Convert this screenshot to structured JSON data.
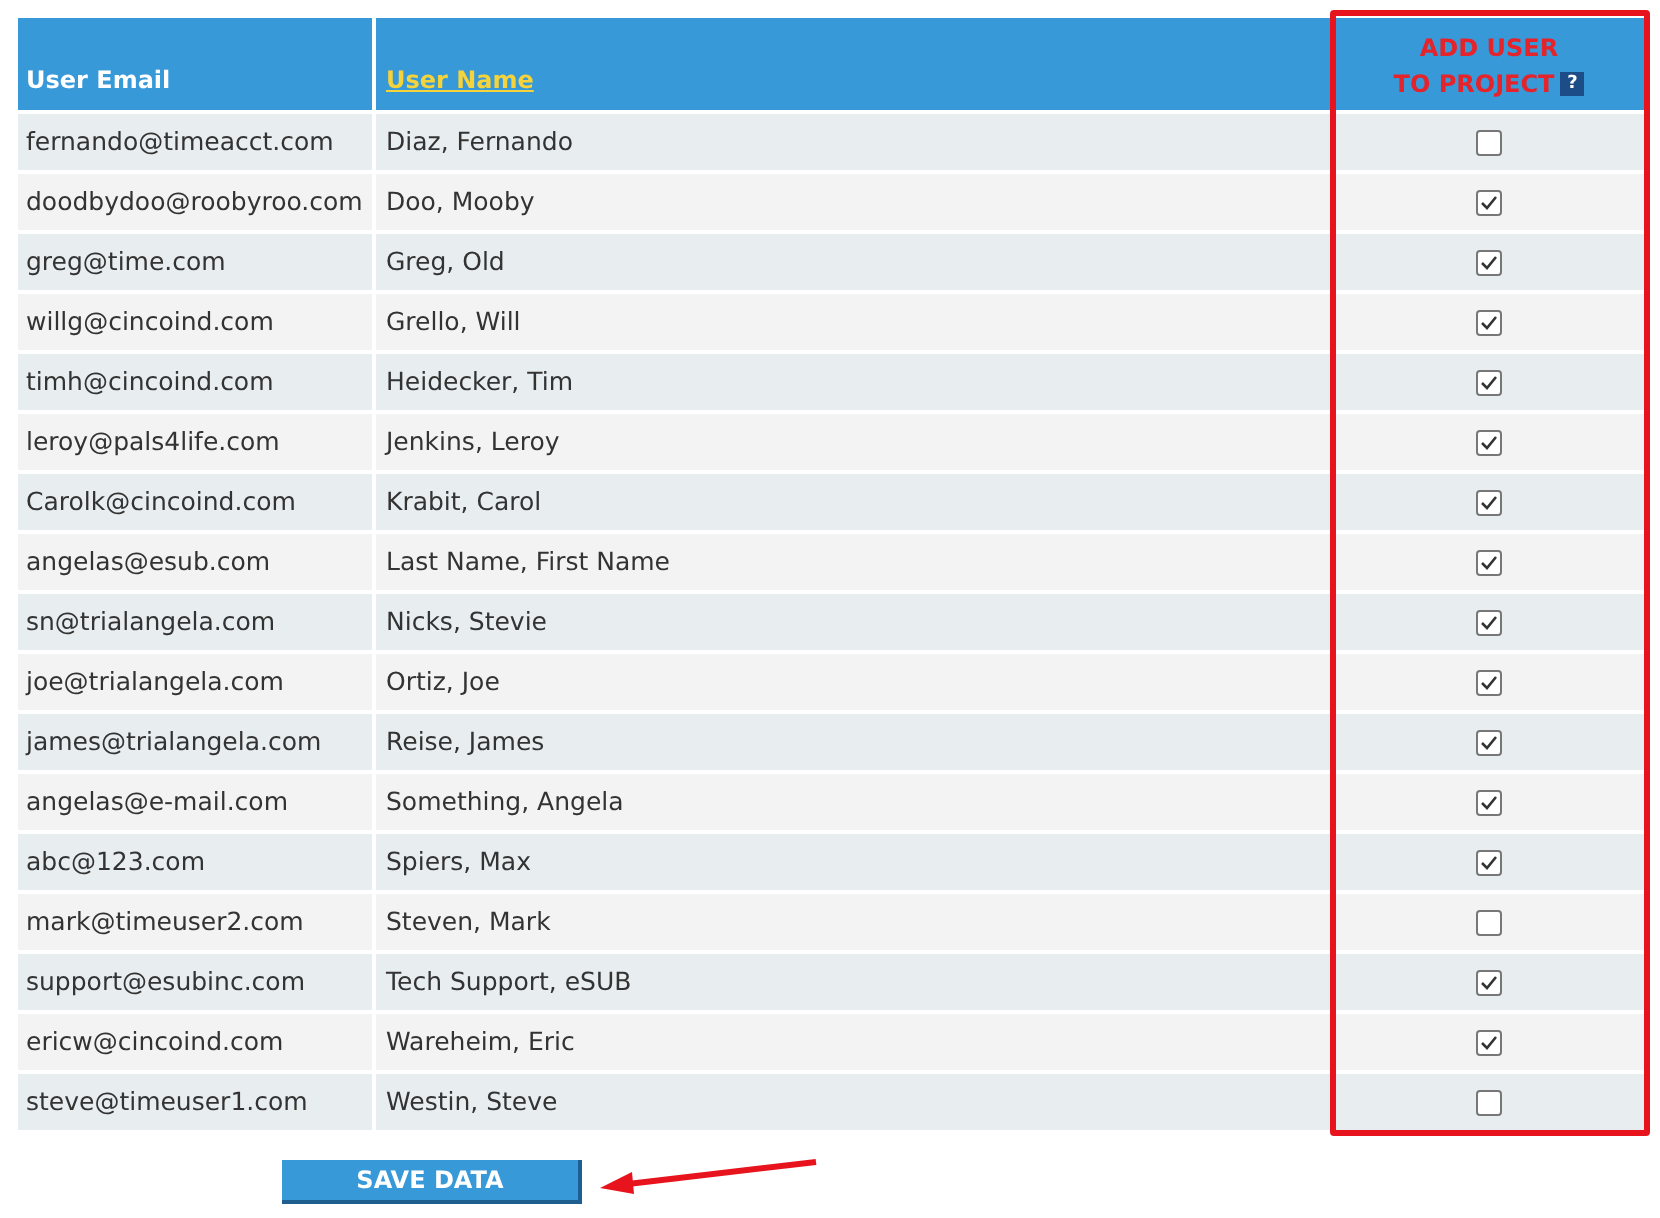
{
  "table": {
    "columns": [
      {
        "label": "User Email",
        "sortable": false
      },
      {
        "label": "User Name",
        "sortable": true
      },
      {
        "label_lines": [
          "ADD USER",
          "TO PROJECT"
        ],
        "help": "?"
      }
    ],
    "rows": [
      {
        "email": "fernando@timeacct.com",
        "name": "Diaz, Fernando",
        "checked": false
      },
      {
        "email": "doodbydoo@roobyroo.com",
        "name": "Doo, Mooby",
        "checked": true
      },
      {
        "email": "greg@time.com",
        "name": "Greg, Old",
        "checked": true
      },
      {
        "email": "willg@cincoind.com",
        "name": "Grello, Will",
        "checked": true
      },
      {
        "email": "timh@cincoind.com",
        "name": "Heidecker, Tim",
        "checked": true
      },
      {
        "email": "leroy@pals4life.com",
        "name": "Jenkins, Leroy",
        "checked": true
      },
      {
        "email": "Carolk@cincoind.com",
        "name": "Krabit, Carol",
        "checked": true
      },
      {
        "email": "angelas@esub.com",
        "name": "Last Name, First Name",
        "checked": true
      },
      {
        "email": "sn@trialangela.com",
        "name": "Nicks, Stevie",
        "checked": true
      },
      {
        "email": "joe@trialangela.com",
        "name": "Ortiz, Joe",
        "checked": true
      },
      {
        "email": "james@trialangela.com",
        "name": "Reise, James",
        "checked": true
      },
      {
        "email": "angelas@e-mail.com",
        "name": "Something, Angela",
        "checked": true
      },
      {
        "email": "abc@123.com",
        "name": "Spiers, Max",
        "checked": true
      },
      {
        "email": "mark@timeuser2.com",
        "name": "Steven, Mark",
        "checked": false
      },
      {
        "email": "support@esubinc.com",
        "name": "Tech Support, eSUB",
        "checked": true
      },
      {
        "email": "ericw@cincoind.com",
        "name": "Wareheim, Eric",
        "checked": true
      },
      {
        "email": "steve@timeuser1.com",
        "name": "Westin, Steve",
        "checked": false
      }
    ]
  },
  "save_button": "SAVE DATA"
}
